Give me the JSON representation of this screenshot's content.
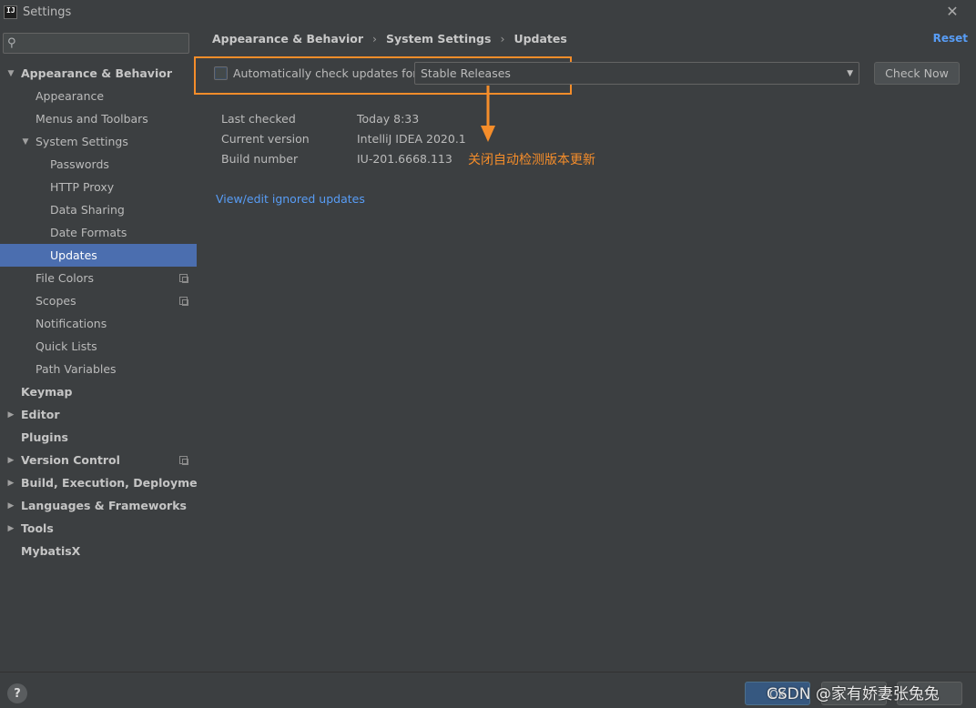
{
  "window": {
    "title": "Settings"
  },
  "search": {
    "placeholder": ""
  },
  "sidebar": {
    "items": [
      {
        "label": "Appearance & Behavior"
      },
      {
        "label": "Appearance"
      },
      {
        "label": "Menus and Toolbars"
      },
      {
        "label": "System Settings"
      },
      {
        "label": "Passwords"
      },
      {
        "label": "HTTP Proxy"
      },
      {
        "label": "Data Sharing"
      },
      {
        "label": "Date Formats"
      },
      {
        "label": "Updates"
      },
      {
        "label": "File Colors"
      },
      {
        "label": "Scopes"
      },
      {
        "label": "Notifications"
      },
      {
        "label": "Quick Lists"
      },
      {
        "label": "Path Variables"
      },
      {
        "label": "Keymap"
      },
      {
        "label": "Editor"
      },
      {
        "label": "Plugins"
      },
      {
        "label": "Version Control"
      },
      {
        "label": "Build, Execution, Deployment"
      },
      {
        "label": "Languages & Frameworks"
      },
      {
        "label": "Tools"
      },
      {
        "label": "MybatisX"
      }
    ]
  },
  "breadcrumb": [
    "Appearance & Behavior",
    "System Settings",
    "Updates"
  ],
  "header": {
    "reset_label": "Reset"
  },
  "updates": {
    "auto_check_label": "Automatically check updates for",
    "auto_check_checked": false,
    "channel_selected": "Stable Releases",
    "check_now_label": "Check Now",
    "info": [
      {
        "label": "Last checked",
        "value": "Today 8:33"
      },
      {
        "label": "Current version",
        "value": "IntelliJ IDEA 2020.1"
      },
      {
        "label": "Build number",
        "value": "IU-201.6668.113"
      }
    ],
    "ignored_link": "View/edit ignored updates"
  },
  "annotation": {
    "text": "关闭自动检测版本更新",
    "color": "#f58d2a"
  },
  "footer": {
    "help_label": "?",
    "ok_label": "OK",
    "watermark": "CSDN @家有娇妻张兔兔"
  },
  "colors": {
    "selection": "#4b6eaf",
    "link": "#589df6",
    "highlight": "#f58d2a",
    "background": "#3c3f41"
  }
}
